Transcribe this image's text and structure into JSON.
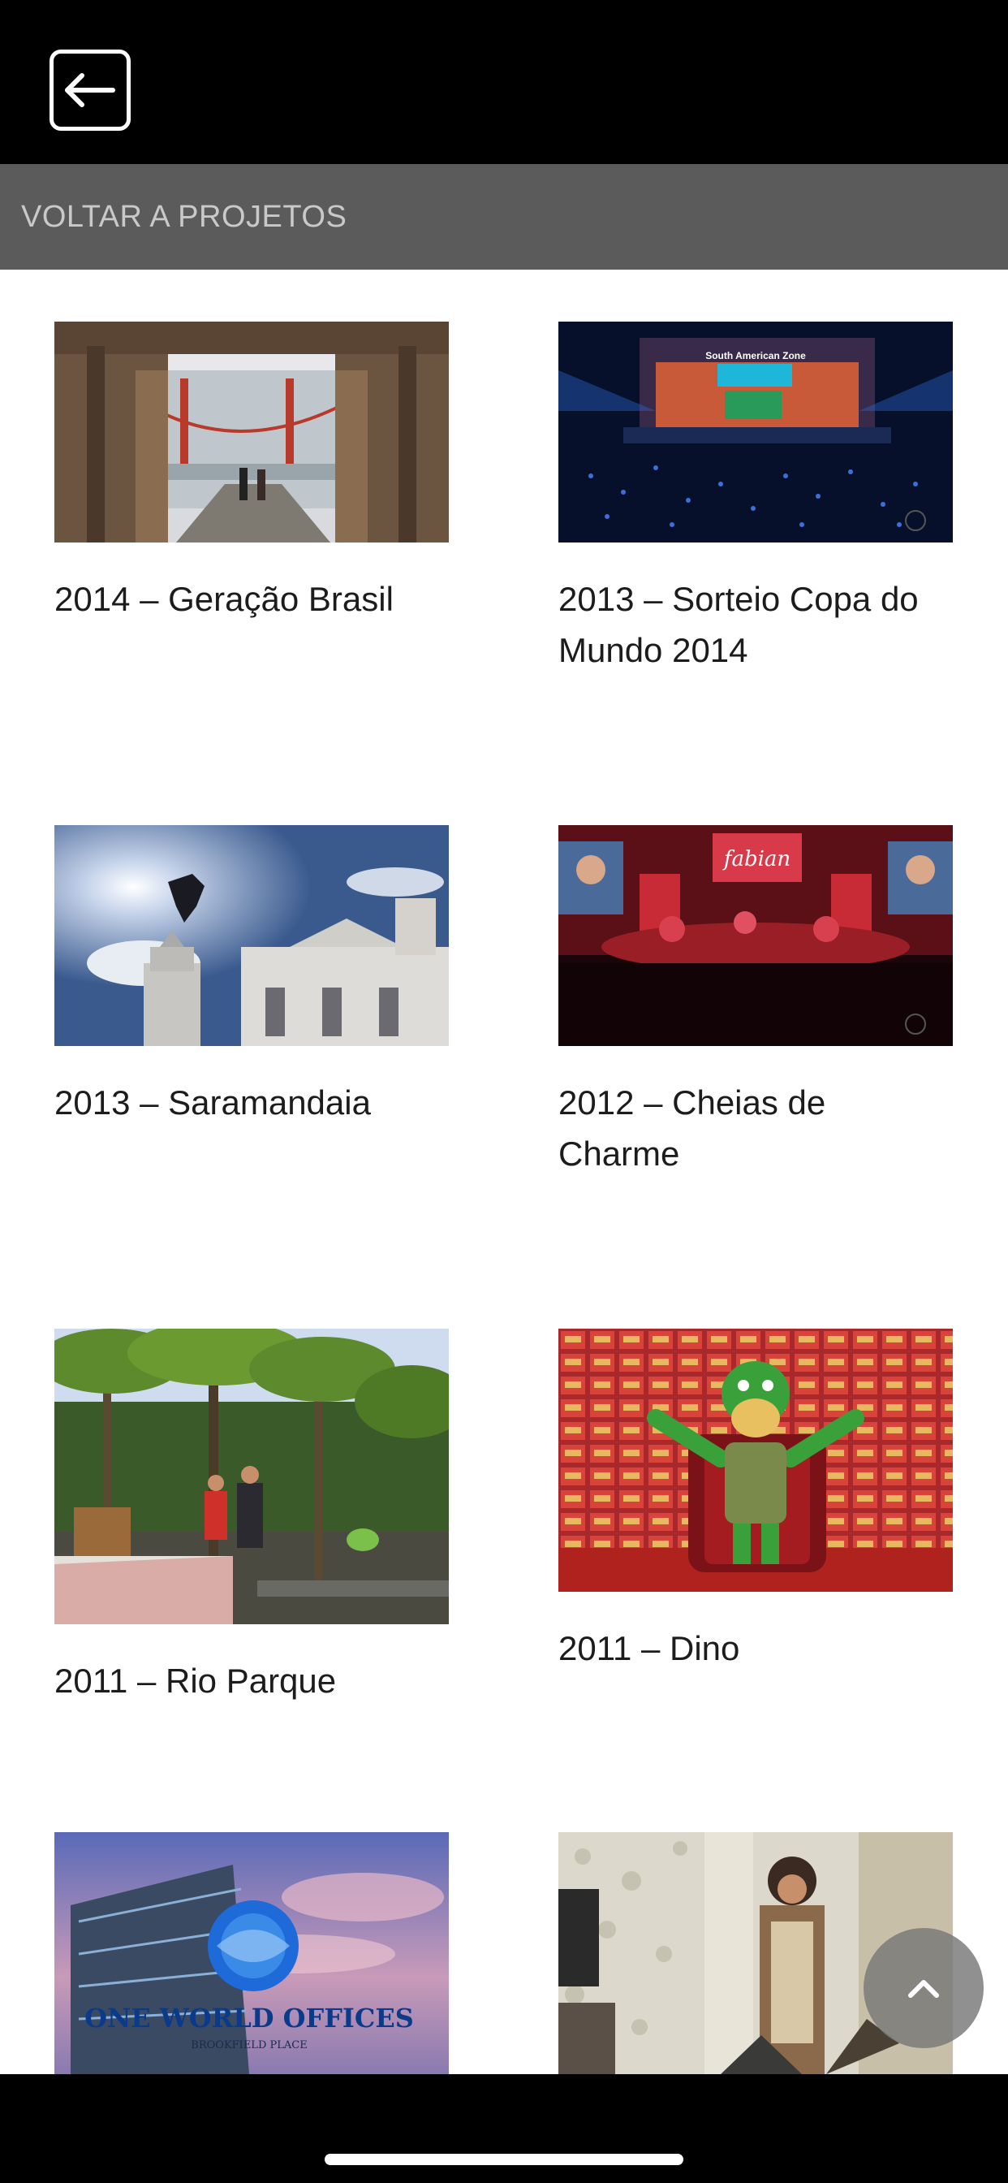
{
  "header": {
    "back_icon": "arrow-left-square-icon",
    "back_to_projects_label": "VOLTAR A PROJETOS"
  },
  "projects": [
    {
      "title": "2014 – Geração Brasil",
      "image": "bridge-golden-gate-scene"
    },
    {
      "title": "2013 – Sorteio Copa do Mundo 2014",
      "image": "stage-event-scene",
      "image_text": "South American Zone"
    },
    {
      "title": "2013 – Saramandaia",
      "image": "flying-man-church-scene"
    },
    {
      "title": "2012 – Cheias de Charme",
      "image": "concert-stage-scene",
      "image_text": "fabian"
    },
    {
      "title": "2011 – Rio Parque",
      "image": "park-palm-trees-scene"
    },
    {
      "title": "2011 – Dino",
      "image": "dino-mascot-throne-scene"
    },
    {
      "title": "",
      "image": "one-world-offices-building",
      "image_text": "ONE WORLD OFFICES",
      "image_subtext": "BROOKFIELD PLACE"
    },
    {
      "title": "",
      "image": "man-in-room-scene"
    }
  ],
  "scroll_top": {
    "icon": "chevron-up-icon"
  },
  "colors": {
    "top_bar": "#000000",
    "subheader": "#5b5b5b",
    "subheader_text": "#c9c9c9",
    "title_text": "#1c1c1c"
  }
}
